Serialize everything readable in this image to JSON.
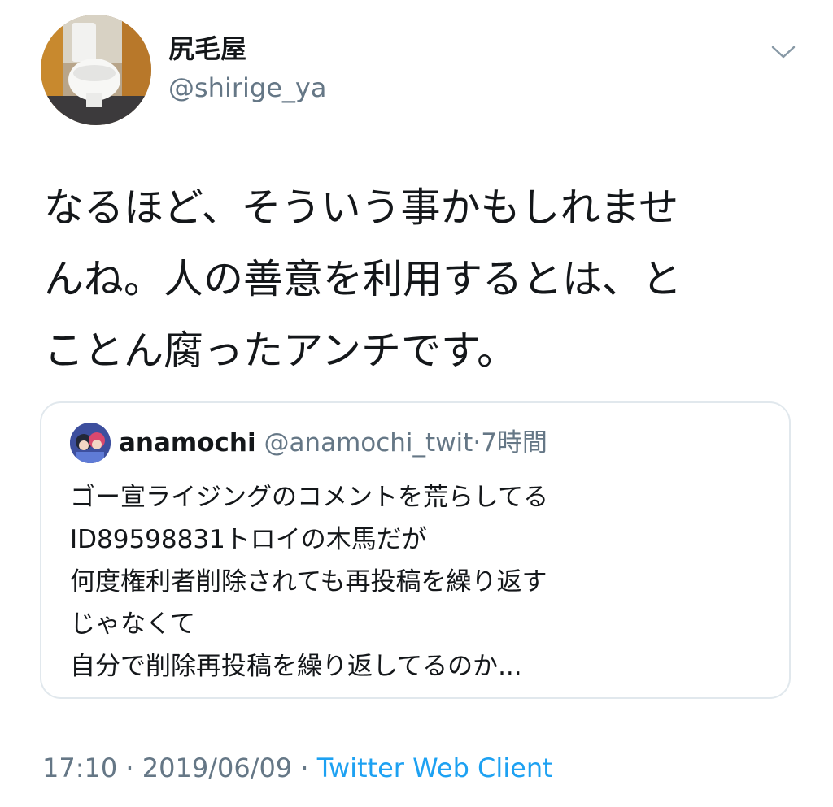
{
  "author": {
    "display_name": "尻毛屋",
    "handle": "@shirige_ya"
  },
  "tweet": {
    "text_lines": [
      "なるほど、そういう事かもしれませ",
      "んね。人の善意を利用するとは、と",
      "ことん腐ったアンチです。"
    ]
  },
  "quoted_tweet": {
    "display_name": "anamochi",
    "handle": "@anamochi_twit",
    "separator": "·",
    "time": "7時間",
    "text_lines": [
      "ゴー宣ライジングのコメントを荒らしてる",
      "ID89598831トロイの木馬だが",
      "何度権利者削除されても再投稿を繰り返す",
      "じゃなくて",
      "自分で削除再投稿を繰り返してるのか..."
    ]
  },
  "meta": {
    "time": "17:10",
    "sep1": "·",
    "date": "2019/06/09",
    "sep2": "·",
    "client": "Twitter Web Client"
  },
  "icons": {
    "menu": "chevron-down-icon"
  },
  "colors": {
    "text_primary": "#14171a",
    "text_secondary": "#657786",
    "link": "#1da1f2",
    "card_border": "#e1e8ed"
  }
}
